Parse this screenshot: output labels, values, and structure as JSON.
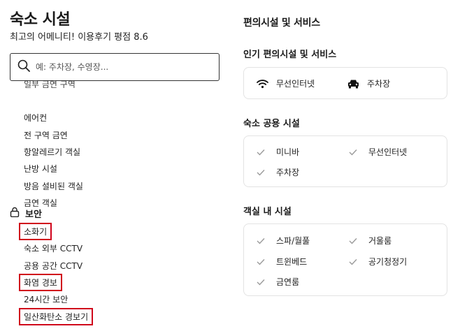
{
  "left": {
    "title": "숙소 시설",
    "subtitle": "최고의 어메니티! 이용후기 평점 8.6",
    "search": {
      "placeholder": "예: 주차장, 수영장..."
    },
    "clipped_item": "일부 금연 구역",
    "items": [
      "에어컨",
      "전 구역 금연",
      "항알레르기 객실",
      "난방 시설",
      "방음 설비된 객실",
      "금연 객실"
    ],
    "security": {
      "title": "보안",
      "items": [
        "소화기",
        "숙소 외부 CCTV",
        "공용 공간 CCTV",
        "화염 경보",
        "24시간 보안",
        "일산화탄소 경보기"
      ]
    }
  },
  "right": {
    "title": "편의시설 및 서비스",
    "popular": {
      "title": "인기 편의시설 및 서비스",
      "items": [
        "무선인터넷",
        "주차장"
      ]
    },
    "shared": {
      "title": "숙소 공용 시설",
      "items": [
        "미니바",
        "무선인터넷",
        "주차장"
      ]
    },
    "room": {
      "title": "객실 내 시설",
      "items": [
        "스파/월풀",
        "거울룸",
        "트윈베드",
        "공기청정기",
        "금연룸"
      ]
    }
  },
  "colors": {
    "highlight": "#d0021b",
    "check": "#9a9a9a",
    "card_border": "#e3e3e3"
  },
  "icons": {
    "search": "search-icon",
    "lock": "lock-icon",
    "wifi": "wifi-icon",
    "car": "car-icon",
    "check": "check-icon"
  }
}
